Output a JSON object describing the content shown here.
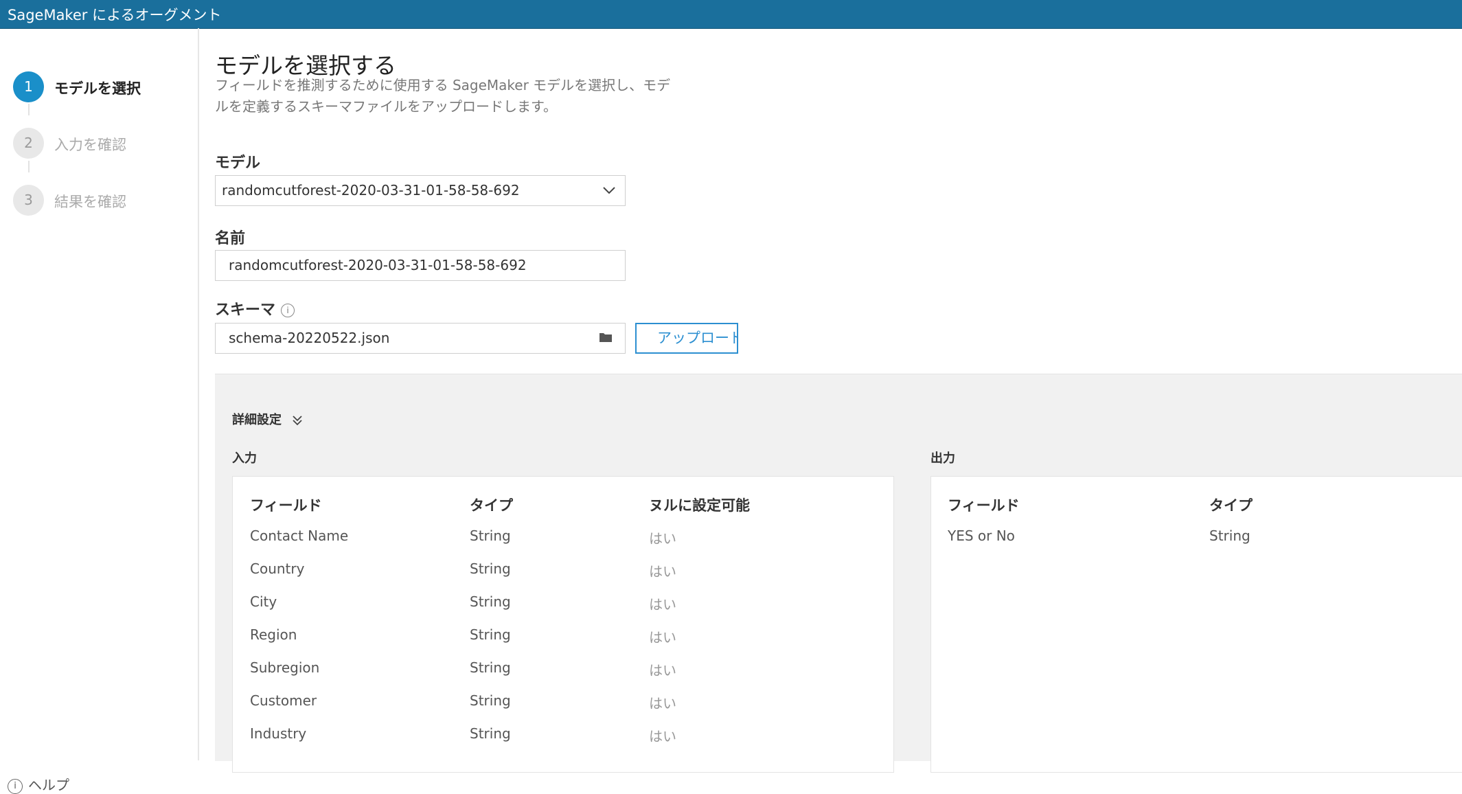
{
  "titlebar": {
    "title": "SageMaker によるオーグメント"
  },
  "sidebar": {
    "steps": [
      {
        "num": "1",
        "label": "モデルを選択"
      },
      {
        "num": "2",
        "label": "入力を確認"
      },
      {
        "num": "3",
        "label": "結果を確認"
      }
    ],
    "help_label": "ヘルプ"
  },
  "main": {
    "title": "モデルを選択する",
    "description": "フィールドを推測するために使用する SageMaker モデルを選択し、モデルを定義するスキーマファイルをアップロードします。",
    "model": {
      "label": "モデル",
      "value": "randomcutforest-2020-03-31-01-58-58-692"
    },
    "name": {
      "label": "名前",
      "value": "randomcutforest-2020-03-31-01-58-58-692"
    },
    "schema": {
      "label": "スキーマ",
      "value": "schema-20220522.json",
      "upload_label": "アップロード"
    }
  },
  "advanced": {
    "toggle_label": "詳細設定",
    "input": {
      "label": "入力",
      "headers": {
        "field": "フィールド",
        "type": "タイプ",
        "nullable": "ヌルに設定可能"
      },
      "rows": [
        {
          "field": "Contact Name",
          "type": "String",
          "nullable": "はい"
        },
        {
          "field": "Country",
          "type": "String",
          "nullable": "はい"
        },
        {
          "field": "City",
          "type": "String",
          "nullable": "はい"
        },
        {
          "field": "Region",
          "type": "String",
          "nullable": "はい"
        },
        {
          "field": "Subregion",
          "type": "String",
          "nullable": "はい"
        },
        {
          "field": "Customer",
          "type": "String",
          "nullable": "はい"
        },
        {
          "field": "Industry",
          "type": "String",
          "nullable": "はい"
        }
      ]
    },
    "output": {
      "label": "出力",
      "headers": {
        "field": "フィールド",
        "type": "タイプ"
      },
      "rows": [
        {
          "field": "YES or No",
          "type": "String"
        }
      ]
    }
  },
  "colors": {
    "titlebar": "#1a6f9c",
    "accent": "#1a8fc9",
    "link": "#2c8fd1"
  }
}
